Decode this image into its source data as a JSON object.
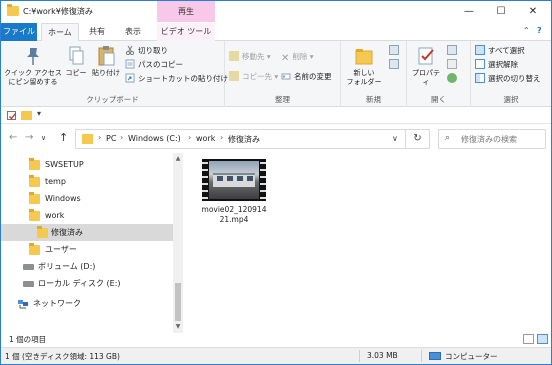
{
  "window": {
    "title": "C:¥work¥修復済み",
    "contextual_tab_group": "再生",
    "controls": {
      "minimize": "—",
      "maximize": "☐",
      "close": "✕"
    }
  },
  "ribbon_tabs": [
    {
      "label": "ファイル"
    },
    {
      "label": "ホーム"
    },
    {
      "label": "共有"
    },
    {
      "label": "表示"
    },
    {
      "label": "ビデオ ツール"
    }
  ],
  "ribbon_toggle": {
    "collapse": "⌃",
    "help": "?"
  },
  "ribbon": {
    "clipboard": {
      "label": "クリップボード",
      "pin": "クイック アクセス\nにピン留めする",
      "copy": "コピー",
      "paste": "貼り付け",
      "cut": "切り取り",
      "copy_path": "パスのコピー",
      "paste_shortcut": "ショートカットの貼り付け"
    },
    "organize": {
      "label": "整理",
      "move_to": "移動先",
      "copy_to": "コピー先",
      "delete": "削除",
      "rename": "名前の変更"
    },
    "new": {
      "label": "新規",
      "new_folder": "新しい\nフォルダー"
    },
    "open": {
      "label": "開く",
      "properties": "プロパティ"
    },
    "select": {
      "label": "選択",
      "select_all": "すべて選択",
      "select_none": "選択解除",
      "invert": "選択の切り替え"
    }
  },
  "address": {
    "breadcrumbs": [
      "PC",
      "Windows (C:)",
      "work",
      "修復済み"
    ],
    "search_placeholder": "修復済みの検索"
  },
  "nav_tree": [
    {
      "label": "SWSETUP",
      "type": "folder"
    },
    {
      "label": "temp",
      "type": "folder"
    },
    {
      "label": "Windows",
      "type": "folder"
    },
    {
      "label": "work",
      "type": "folder"
    },
    {
      "label": "修復済み",
      "type": "folder",
      "selected": true
    },
    {
      "label": "ユーザー",
      "type": "folder"
    },
    {
      "label": "ボリューム (D:)",
      "type": "drive"
    },
    {
      "label": "ローカル ディスク (E:)",
      "type": "drive"
    },
    {
      "label": "ネットワーク",
      "type": "network"
    }
  ],
  "files": [
    {
      "name": "movie02_12091421.mp4",
      "icon": "video-thumbnail"
    }
  ],
  "status": {
    "item_count": "1 個の項目",
    "summary": "1 個 (空きディスク領域: 113 GB)",
    "size": "3.03 MB",
    "location": "コンピューター"
  }
}
